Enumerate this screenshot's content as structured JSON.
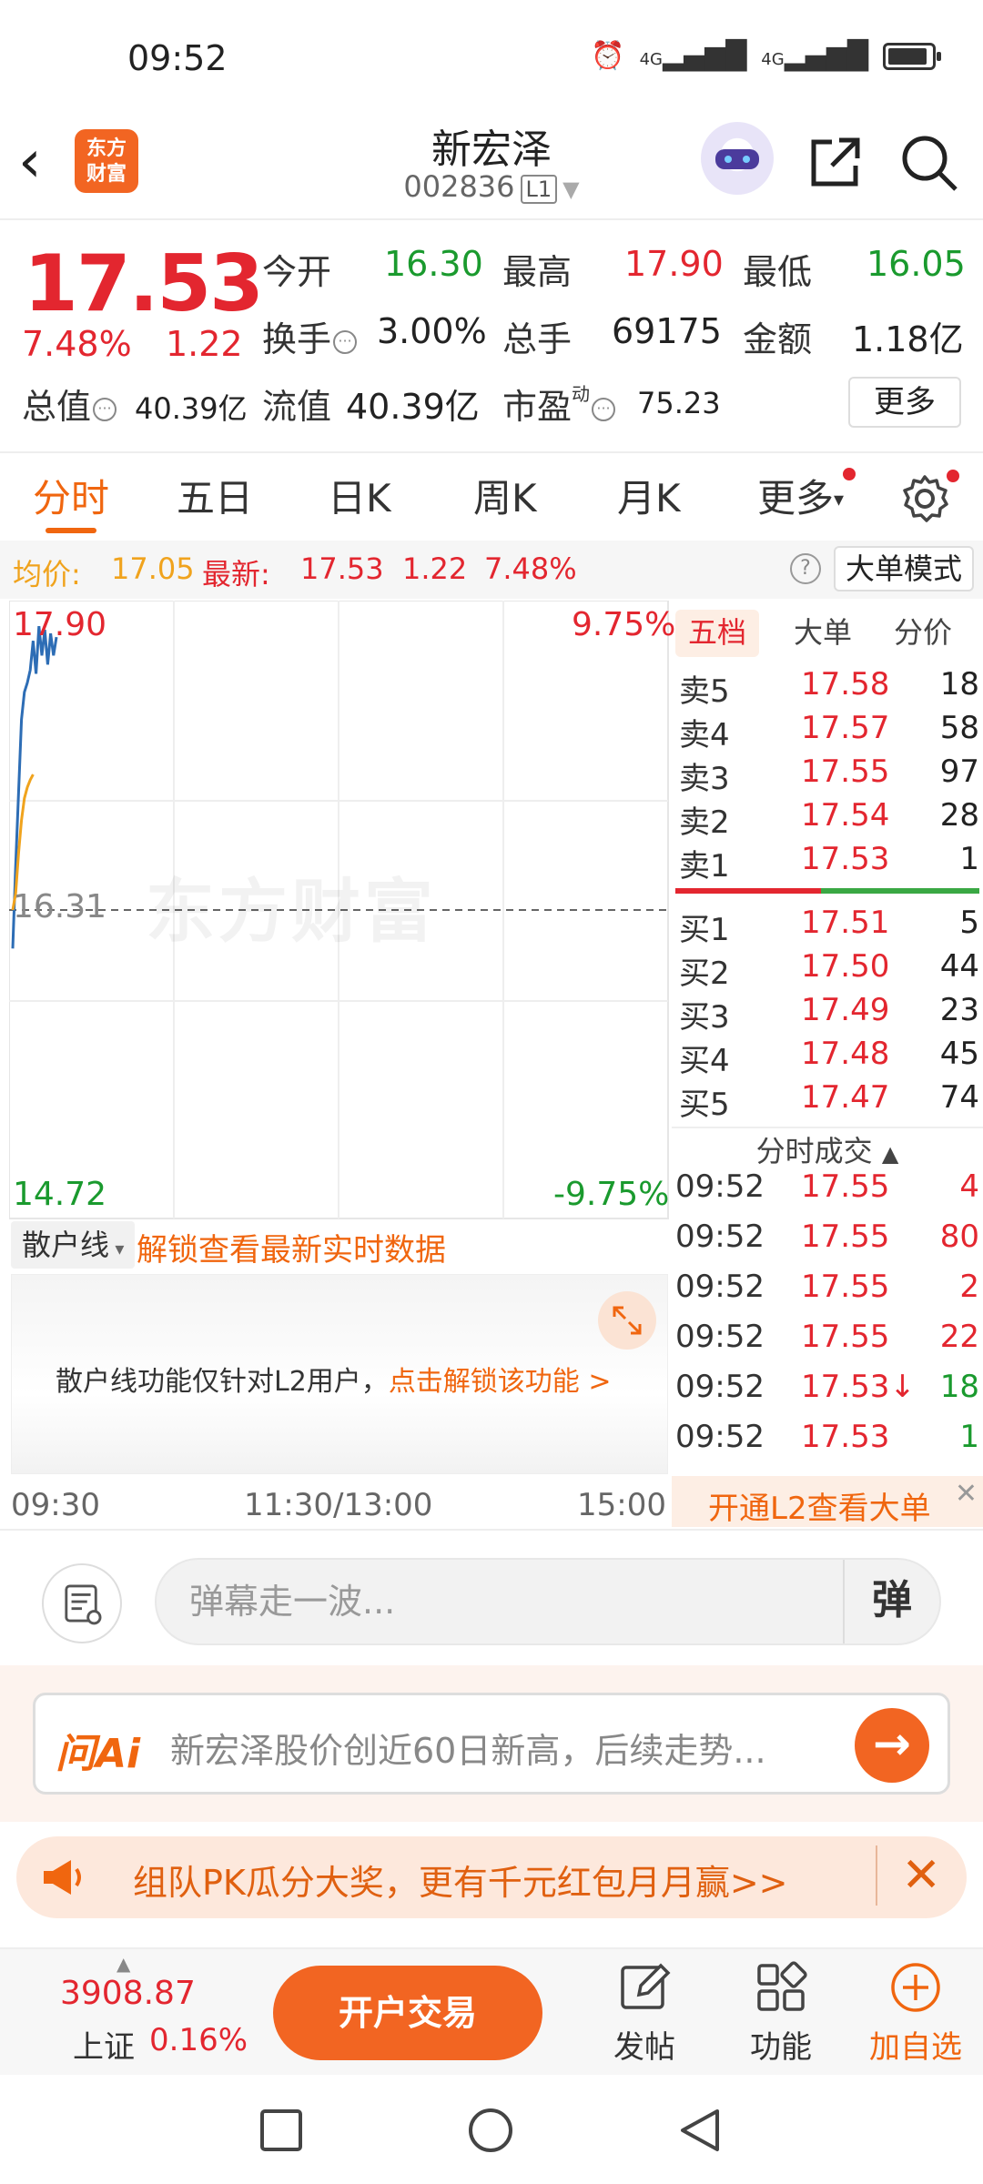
{
  "status_bar": {
    "time": "09:52",
    "signal1": "4G",
    "signal2": "4G"
  },
  "header": {
    "stock_name": "新宏泽",
    "stock_code": "002836",
    "level_badge": "L1",
    "logo_text_line1": "东方",
    "logo_text_line2": "财富"
  },
  "quote": {
    "price": "17.53",
    "change_pct": "7.48%",
    "change_val": "1.22",
    "open_label": "今开",
    "open": "16.30",
    "high_label": "最高",
    "high": "17.90",
    "low_label": "最低",
    "low": "16.05",
    "turnover_label": "换手",
    "turnover": "3.00%",
    "volume_label": "总手",
    "volume": "69175",
    "amount_label": "金额",
    "amount": "1.18亿",
    "total_value_label": "总值",
    "total_value": "40.39亿",
    "float_value_label": "流值",
    "float_value": "40.39亿",
    "pe_label": "市盈",
    "pe_sup": "动",
    "pe": "75.23",
    "more_button": "更多"
  },
  "tabs": [
    {
      "label": "分时",
      "active": true
    },
    {
      "label": "五日"
    },
    {
      "label": "日K"
    },
    {
      "label": "周K"
    },
    {
      "label": "月K"
    },
    {
      "label": "更多"
    }
  ],
  "avg_bar": {
    "avg_label": "均价:",
    "avg_value": "17.05",
    "latest_label": "最新:",
    "latest_value": "17.53",
    "latest_change": "1.22",
    "latest_pct": "7.48%",
    "big_order_mode": "大单模式"
  },
  "chart": {
    "top_price": "17.90",
    "top_pct": "9.75%",
    "mid_price": "16.31",
    "bottom_price": "14.72",
    "bottom_pct": "-9.75%",
    "watermark": "东方财富",
    "time_start": "09:30",
    "time_mid": "11:30/13:00",
    "time_end": "15:00"
  },
  "chart_data": {
    "type": "line",
    "ylim": [
      14.72,
      17.9
    ],
    "series": [
      {
        "name": "price",
        "color": "#2d6db5",
        "values": [
          16.1,
          16.55,
          16.95,
          17.35,
          17.5,
          17.55,
          17.62,
          17.78,
          17.6,
          17.86,
          17.7,
          17.84,
          17.65,
          17.82,
          17.7,
          17.8
        ]
      },
      {
        "name": "avg",
        "color": "#f0a31d",
        "values": [
          16.31,
          16.4,
          16.62,
          16.8,
          16.92,
          16.98,
          17.02,
          17.05
        ]
      }
    ]
  },
  "order_book": {
    "tabs": [
      "五档",
      "大单",
      "分价"
    ],
    "asks": [
      {
        "label": "卖5",
        "price": "17.58",
        "vol": "18"
      },
      {
        "label": "卖4",
        "price": "17.57",
        "vol": "58"
      },
      {
        "label": "卖3",
        "price": "17.55",
        "vol": "97"
      },
      {
        "label": "卖2",
        "price": "17.54",
        "vol": "28"
      },
      {
        "label": "卖1",
        "price": "17.53",
        "vol": "1"
      }
    ],
    "bids": [
      {
        "label": "买1",
        "price": "17.51",
        "vol": "5"
      },
      {
        "label": "买2",
        "price": "17.50",
        "vol": "44"
      },
      {
        "label": "买3",
        "price": "17.49",
        "vol": "23"
      },
      {
        "label": "买4",
        "price": "17.48",
        "vol": "45"
      },
      {
        "label": "买5",
        "price": "17.47",
        "vol": "74"
      }
    ],
    "ticks_title": "分时成交",
    "ticks": [
      {
        "time": "09:52",
        "price": "17.55",
        "vol": "4",
        "vol_color": "red"
      },
      {
        "time": "09:52",
        "price": "17.55",
        "vol": "80",
        "vol_color": "red"
      },
      {
        "time": "09:52",
        "price": "17.55",
        "vol": "2",
        "vol_color": "red"
      },
      {
        "time": "09:52",
        "price": "17.55",
        "vol": "22",
        "vol_color": "red"
      },
      {
        "time": "09:52",
        "price": "17.53↓",
        "vol": "18",
        "vol_color": "green"
      },
      {
        "time": "09:52",
        "price": "17.53",
        "vol": "1",
        "vol_color": "green"
      }
    ],
    "l2_open": "开通L2查看大单"
  },
  "retail": {
    "select_label": "散户线",
    "unlock_link": "解锁查看最新实时数据",
    "panel_text": "散户线功能仅针对L2用户，",
    "panel_link": "点击解锁该功能 >"
  },
  "danmu": {
    "placeholder": "弹幕走一波...",
    "send": "弹"
  },
  "ai": {
    "logo": "问Ai",
    "text": "新宏泽股价创近60日新高，后续走势..."
  },
  "promo": {
    "text": "组队PK瓜分大奖，更有千元红包月月赢>>"
  },
  "bottom": {
    "index_value": "3908.87",
    "index_name": "上证",
    "index_pct": "0.16%",
    "open_account": "开户交易",
    "post": "发帖",
    "functions": "功能",
    "add_watch": "加自选"
  },
  "colors": {
    "up": "#e3262f",
    "down": "#1a9a2e",
    "accent": "#f0660f"
  }
}
